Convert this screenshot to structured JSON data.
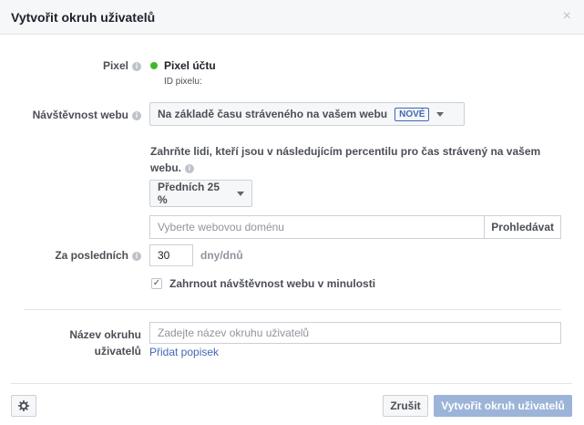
{
  "dialog": {
    "title": "Vytvořit okruh uživatelů",
    "close_glyph": "×"
  },
  "pixel": {
    "label": "Pixel",
    "status_color": "#42b72a",
    "name": "Pixel účtu",
    "id_label": "ID pixelu:"
  },
  "traffic": {
    "label": "Návštěvnost webu",
    "selected": "Na základě času stráveného na vašem webu",
    "badge": "NOVÉ"
  },
  "description": "Zahrňte lidi, kteří jsou v následujícím percentilu pro čas strávený na vašem webu.",
  "percentile": {
    "selected": "Předních 25 %"
  },
  "domain_search": {
    "placeholder": "Vyberte webovou doménu",
    "button_label": "Prohledávat"
  },
  "retention": {
    "label": "Za posledních",
    "value": "30",
    "unit": "dny/dnů"
  },
  "include_past": {
    "checked": true,
    "label": "Zahrnout návštěvnost webu v minulosti"
  },
  "audience_name": {
    "label_line1": "Název okruhu",
    "label_line2": "uživatelů",
    "placeholder": "Zadejte název okruhu uživatelů",
    "add_description_link": "Přidat popisek"
  },
  "footer": {
    "settings_icon": "gear-icon",
    "cancel_label": "Zrušit",
    "create_label": "Vytvořit okruh uživatelů"
  },
  "colors": {
    "accent": "#4267b2",
    "disabled_primary": "#9cb4d8"
  }
}
